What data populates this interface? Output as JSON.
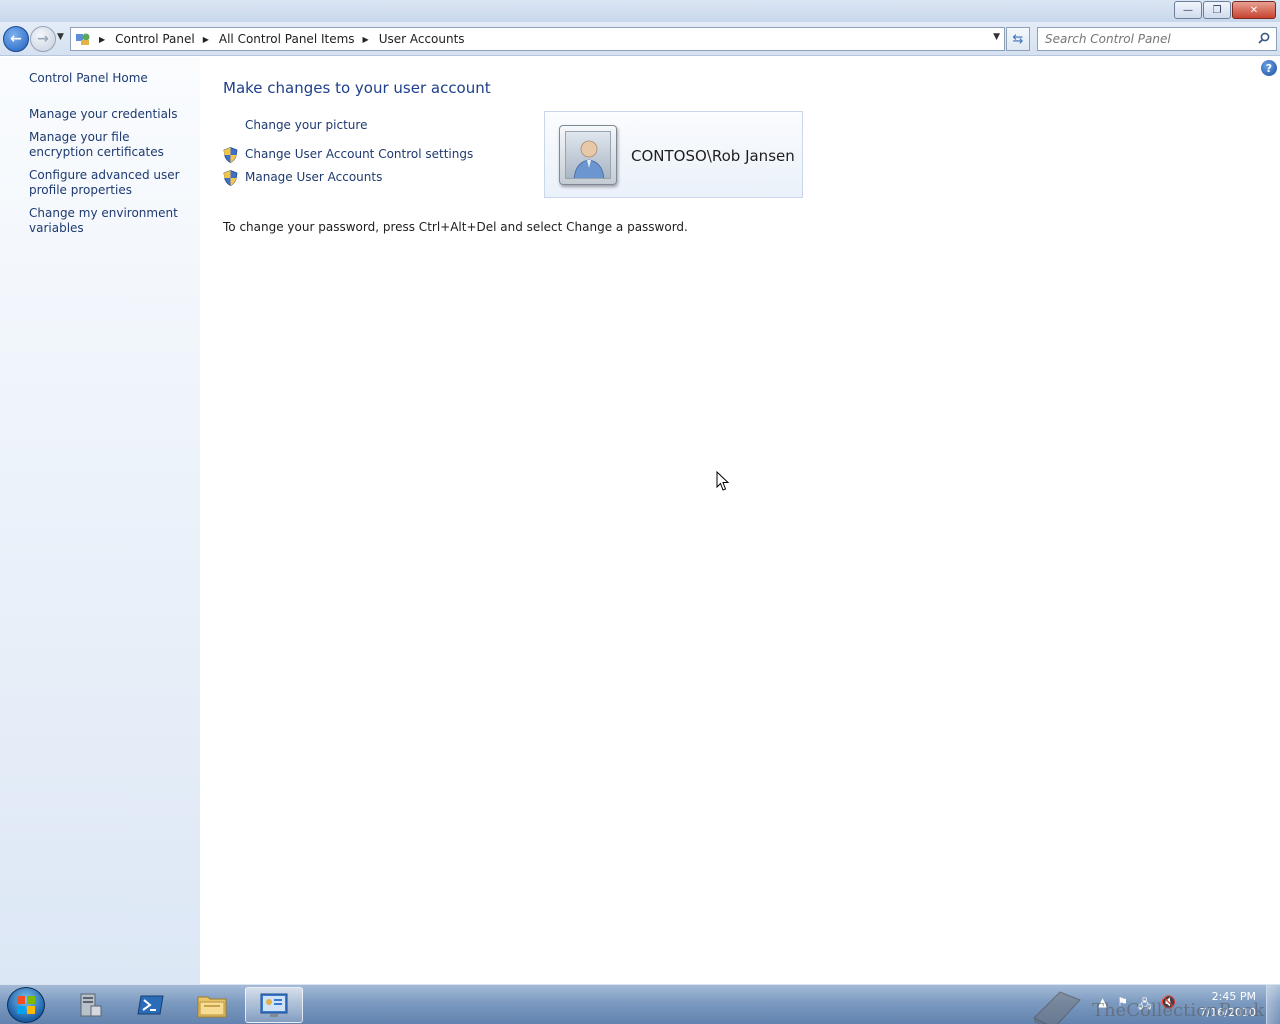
{
  "window": {
    "minimize_glyph": "—",
    "maximize_glyph": "❐",
    "close_glyph": "✕"
  },
  "navigation": {
    "back_glyph": "←",
    "forward_glyph": "→",
    "breadcrumbs": [
      "Control Panel",
      "All Control Panel Items",
      "User Accounts"
    ],
    "search_placeholder": "Search Control Panel"
  },
  "left_pane": {
    "home": "Control Panel Home",
    "links": [
      "Manage your credentials",
      "Manage your file encryption certificates",
      "Configure advanced user profile properties",
      "Change my environment variables"
    ]
  },
  "main": {
    "title": "Make changes to your user account",
    "tasks": [
      "Change your picture",
      "Change User Account Control settings",
      "Manage User Accounts"
    ],
    "user_name": "CONTOSO\\Rob Jansen",
    "password_note": "To change your password, press Ctrl+Alt+Del and select Change a password."
  },
  "taskbar": {
    "time": "2:45 PM",
    "date": "7/16/2010",
    "watermark": "TheCollectionBook"
  }
}
